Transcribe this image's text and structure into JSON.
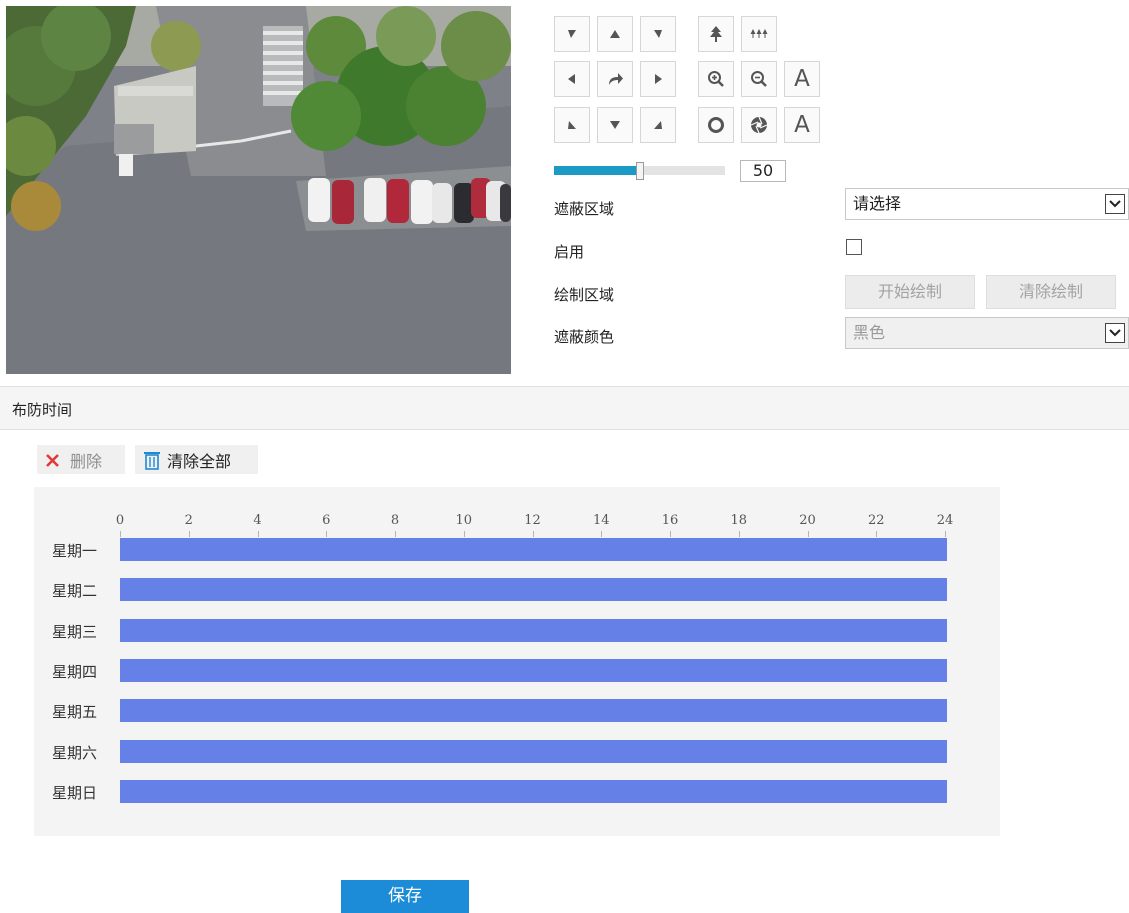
{
  "ptz": {
    "focus_label": "A",
    "iris_label": "A"
  },
  "slider": {
    "value": "50",
    "fraction": 0.5
  },
  "form": {
    "mask_area": {
      "label": "遮蔽区域",
      "value": "请选择"
    },
    "enable": {
      "label": "启用",
      "checked": false
    },
    "draw_area": {
      "label": "绘制区域",
      "start_label": "开始绘制",
      "clear_label": "清除绘制"
    },
    "mask_color": {
      "label": "遮蔽颜色",
      "value": "黑色"
    }
  },
  "section": {
    "title": "布防时间"
  },
  "toolbar": {
    "delete_label": "删除",
    "clear_all_label": "清除全部"
  },
  "schedule": {
    "hours": [
      "0",
      "2",
      "4",
      "6",
      "8",
      "10",
      "12",
      "14",
      "16",
      "18",
      "20",
      "22",
      "24"
    ],
    "days": [
      {
        "label": "星期一",
        "start": 0,
        "end": 24
      },
      {
        "label": "星期二",
        "start": 0,
        "end": 24
      },
      {
        "label": "星期三",
        "start": 0,
        "end": 24
      },
      {
        "label": "星期四",
        "start": 0,
        "end": 24
      },
      {
        "label": "星期五",
        "start": 0,
        "end": 24
      },
      {
        "label": "星期六",
        "start": 0,
        "end": 24
      },
      {
        "label": "星期日",
        "start": 0,
        "end": 24
      }
    ]
  },
  "save_label": "保存",
  "colors": {
    "slider_fill": "#1b9bc3",
    "schedule_bar": "#6580e6",
    "save_button": "#1d8cd8",
    "delete_icon": "#e03a3a",
    "trash_icon": "#1e8ad6"
  }
}
